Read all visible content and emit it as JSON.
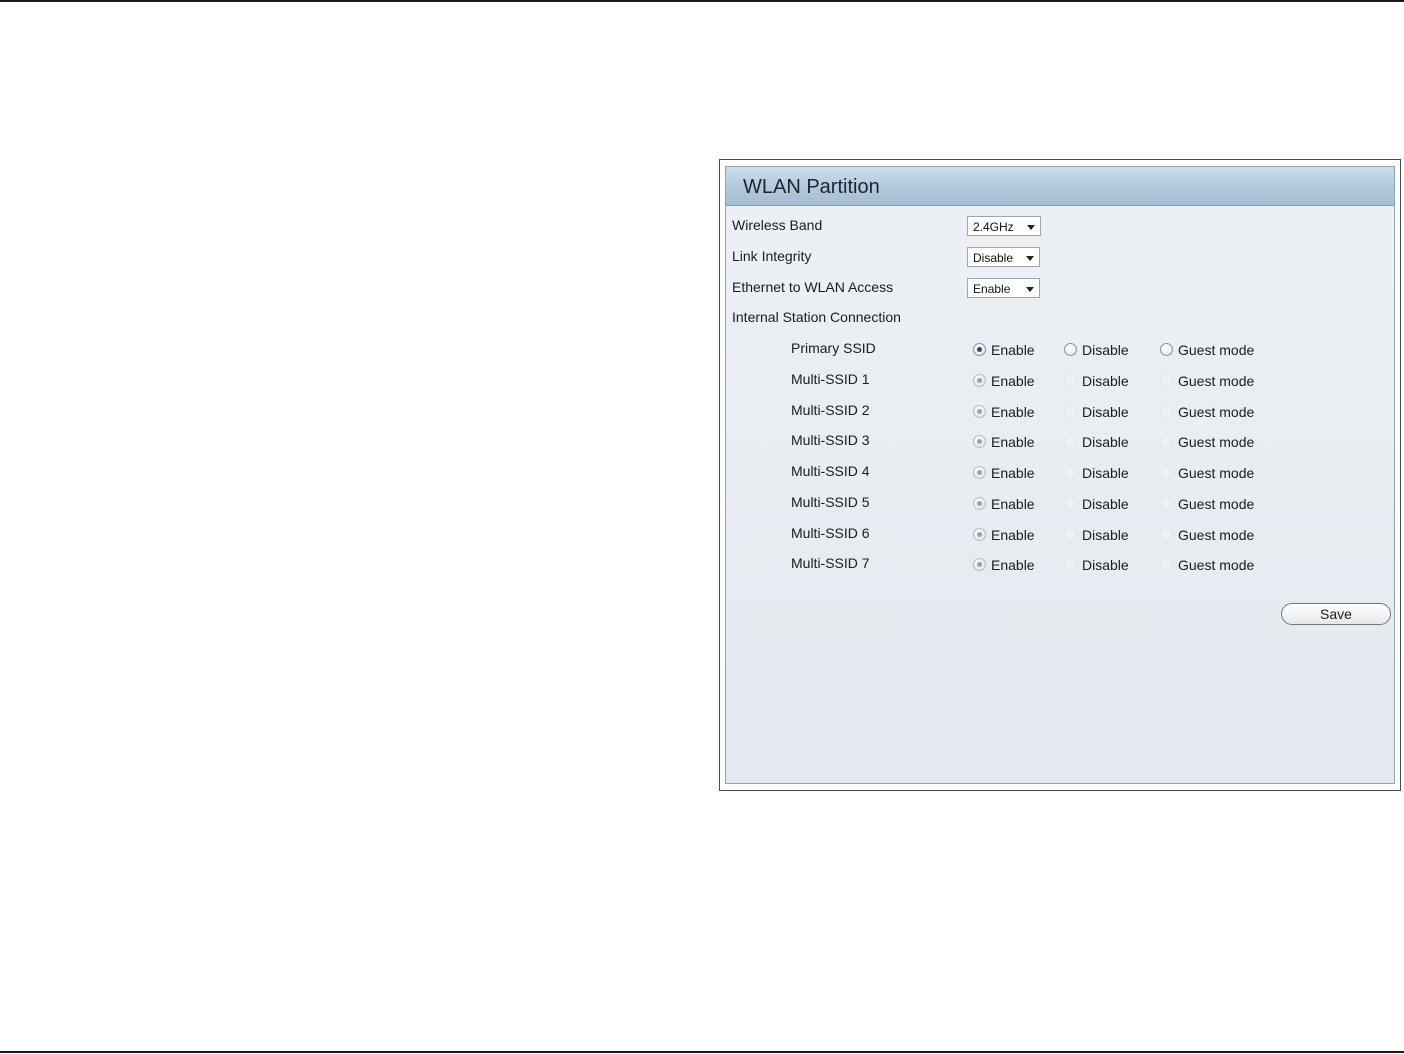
{
  "panel": {
    "title": "WLAN Partition"
  },
  "fields": {
    "wireless_band": {
      "label": "Wireless Band",
      "value": "2.4GHz"
    },
    "link_integrity": {
      "label": "Link Integrity",
      "value": "Disable"
    },
    "ethernet_wlan": {
      "label": "Ethernet to WLAN Access",
      "value": "Enable"
    }
  },
  "internal_station": {
    "label": "Internal Station Connection",
    "options": [
      "Enable",
      "Disable",
      "Guest mode"
    ],
    "rows": [
      {
        "name": "Primary SSID",
        "selected": "Enable"
      },
      {
        "name": "Multi-SSID 1",
        "selected": "Enable"
      },
      {
        "name": "Multi-SSID 2",
        "selected": "Enable"
      },
      {
        "name": "Multi-SSID 3",
        "selected": "Enable"
      },
      {
        "name": "Multi-SSID 4",
        "selected": "Enable"
      },
      {
        "name": "Multi-SSID 5",
        "selected": "Enable"
      },
      {
        "name": "Multi-SSID 6",
        "selected": "Enable"
      },
      {
        "name": "Multi-SSID 7",
        "selected": "Enable"
      }
    ]
  },
  "actions": {
    "save_label": "Save"
  },
  "colors": {
    "header": "#b3cade",
    "panel_bg": "#e8edf2",
    "radio_dot": "#2b4a6f"
  }
}
